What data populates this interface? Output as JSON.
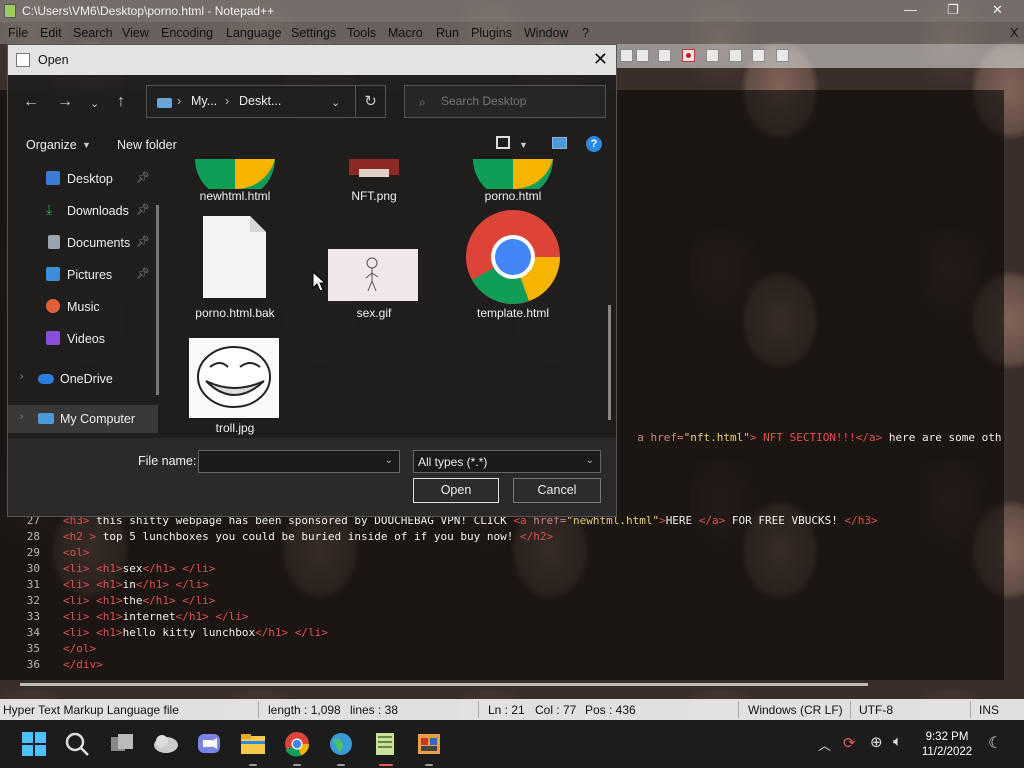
{
  "npp": {
    "title": "C:\\Users\\VM6\\Desktop\\porno.html - Notepad++",
    "menu": [
      "File",
      "Edit",
      "Search",
      "View",
      "Encoding",
      "Language",
      "Settings",
      "Tools",
      "Macro",
      "Run",
      "Plugins",
      "Window",
      "?"
    ],
    "menu_close": "X",
    "code_line_tail": {
      "a1": "a href=",
      "s1": "\"nft.html\"",
      "t1": "> NFT SECTION!!!",
      "a2": "</a>",
      "t2": " here are some oth"
    },
    "code_lines": [
      {
        "num": "27",
        "parts": [
          {
            "c": "tag",
            "t": "<h3>"
          },
          {
            "c": "txt",
            "t": " this shitty webpage has been sponsored by DOUCHEBAG VPN! CLICK "
          },
          {
            "c": "tag",
            "t": "<a "
          },
          {
            "c": "attr",
            "t": "href="
          },
          {
            "c": "str",
            "t": "\"newhtml.html\""
          },
          {
            "c": "tag",
            "t": ">"
          },
          {
            "c": "txt",
            "t": "HERE "
          },
          {
            "c": "tag",
            "t": "</a>"
          },
          {
            "c": "txt",
            "t": " FOR FREE VBUCKS! "
          },
          {
            "c": "tag",
            "t": "</h3>"
          }
        ]
      },
      {
        "num": "28",
        "parts": [
          {
            "c": "tag",
            "t": "<h2 >"
          },
          {
            "c": "txt",
            "t": " top 5 lunchboxes you could be buried inside of if you buy now! "
          },
          {
            "c": "tag",
            "t": "</h2>"
          }
        ]
      },
      {
        "num": "29",
        "parts": [
          {
            "c": "tag",
            "t": "<ol>"
          }
        ]
      },
      {
        "num": "30",
        "parts": [
          {
            "c": "tag",
            "t": "<li> <h1>"
          },
          {
            "c": "txt",
            "t": "sex"
          },
          {
            "c": "tag",
            "t": "</h1> </li>"
          }
        ]
      },
      {
        "num": "31",
        "parts": [
          {
            "c": "tag",
            "t": "<li> <h1>"
          },
          {
            "c": "txt",
            "t": "in"
          },
          {
            "c": "tag",
            "t": "</h1> </li>"
          }
        ]
      },
      {
        "num": "32",
        "parts": [
          {
            "c": "tag",
            "t": "<li> <h1>"
          },
          {
            "c": "txt",
            "t": "the"
          },
          {
            "c": "tag",
            "t": "</h1> </li>"
          }
        ]
      },
      {
        "num": "33",
        "parts": [
          {
            "c": "tag",
            "t": "<li> <h1>"
          },
          {
            "c": "txt",
            "t": "internet"
          },
          {
            "c": "tag",
            "t": "</h1> </li>"
          }
        ]
      },
      {
        "num": "34",
        "parts": [
          {
            "c": "tag",
            "t": "<li> <h1>"
          },
          {
            "c": "txt",
            "t": "hello kitty lunchbox"
          },
          {
            "c": "tag",
            "t": "</h1> </li>"
          }
        ]
      },
      {
        "num": "35",
        "parts": [
          {
            "c": "tag",
            "t": "</ol>"
          }
        ]
      },
      {
        "num": "36",
        "parts": [
          {
            "c": "tag",
            "t": "</div>"
          }
        ]
      }
    ],
    "status": {
      "file_type": "Hyper Text Markup Language file",
      "length": "length : 1,098",
      "lines": "lines : 38",
      "ln": "Ln : 21",
      "col": "Col : 77",
      "pos": "Pos : 436",
      "eol": "Windows (CR LF)",
      "encoding": "UTF-8",
      "mode": "INS"
    }
  },
  "dialog": {
    "title": "Open",
    "close": "✕",
    "address": [
      "My...",
      "Deskt..."
    ],
    "search_placeholder": "Search Desktop",
    "organize": "Organize",
    "new_folder": "New folder",
    "help": "?",
    "sidebar": [
      {
        "label": "Desktop",
        "pinned": true,
        "color": "#3a7bd5"
      },
      {
        "label": "Downloads",
        "pinned": true,
        "color": "#2fa84f"
      },
      {
        "label": "Documents",
        "pinned": true,
        "color": "#9aa4b0"
      },
      {
        "label": "Pictures",
        "pinned": true,
        "color": "#3a8fd8"
      },
      {
        "label": "Music",
        "pinned": false,
        "color": "#e0603a"
      },
      {
        "label": "Videos",
        "pinned": false,
        "color": "#8a4fd8"
      },
      {
        "label": "OneDrive",
        "pinned": false,
        "color": "#2a7ee0"
      },
      {
        "label": "My Computer",
        "pinned": false,
        "color": "#4a9ad8"
      }
    ],
    "files": [
      {
        "name": "newhtml.html",
        "kind": "chrome-partial"
      },
      {
        "name": "NFT.png",
        "kind": "image-partial"
      },
      {
        "name": "porno.html",
        "kind": "chrome-partial"
      },
      {
        "name": "porno.html.bak",
        "kind": "blank"
      },
      {
        "name": "sex.gif",
        "kind": "stickman"
      },
      {
        "name": "template.html",
        "kind": "chrome"
      },
      {
        "name": "troll.jpg",
        "kind": "trollface"
      }
    ],
    "file_name_label": "File name:",
    "file_name_value": "",
    "file_type": "All types (*.*)",
    "open_button": "Open",
    "cancel_button": "Cancel"
  },
  "taskbar": {
    "time": "9:32 PM",
    "date": "11/2/2022"
  }
}
